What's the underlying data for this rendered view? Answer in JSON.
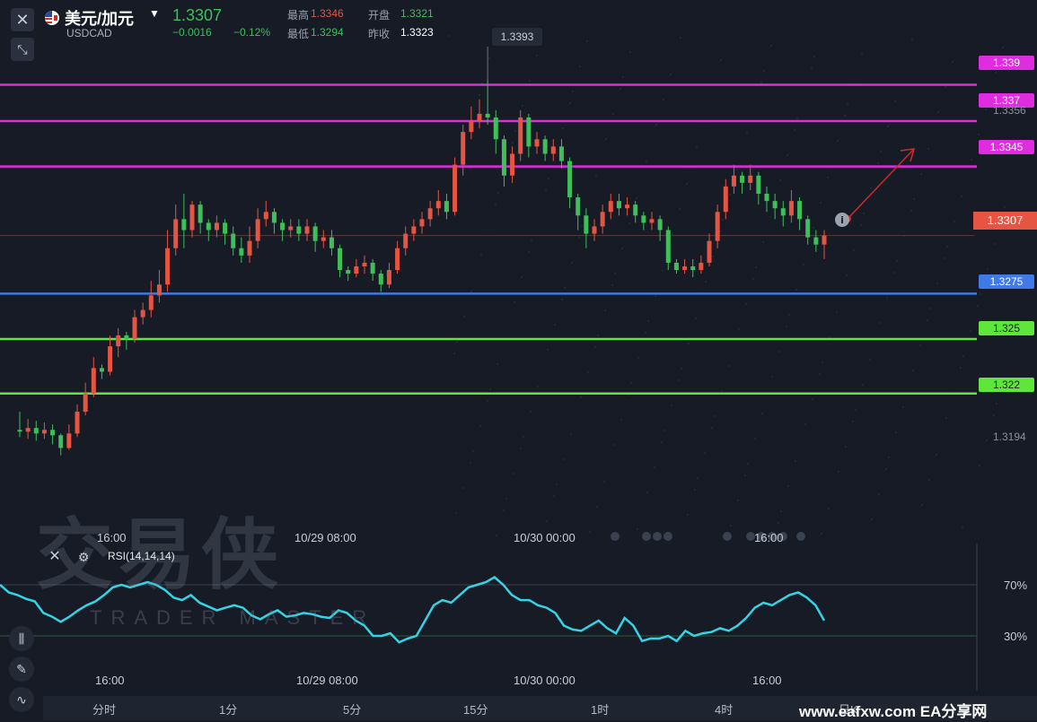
{
  "header": {
    "symbol_title": "美元/加元",
    "symbol_code": "USDCAD",
    "last_price": "1.3307",
    "change_abs": "−0.0016",
    "change_pct": "−0.12%",
    "stats": [
      {
        "label": "最高",
        "value": "1.3346",
        "color": "#e65442"
      },
      {
        "label": "开盘",
        "value": "1.3321",
        "color": "#3fbf5a"
      },
      {
        "label": "最低",
        "value": "1.3294",
        "color": "#3fbf5a"
      },
      {
        "label": "昨收",
        "value": "1.3323",
        "color": "#ffffff"
      }
    ]
  },
  "icons": {
    "close": "close-icon",
    "collapse": "collapse-icon",
    "gear": "gear-icon",
    "info": "info-icon"
  },
  "price_levels": [
    {
      "label": "1.339",
      "value": 1.339,
      "color": "#e02ce0"
    },
    {
      "label": "1.337",
      "value": 1.337,
      "color": "#e02ce0"
    },
    {
      "label": "1.3345",
      "value": 1.3345,
      "color": "#e02ce0"
    },
    {
      "label": "1.3275",
      "value": 1.3275,
      "color": "#3f7ae6"
    },
    {
      "label": "1.325",
      "value": 1.325,
      "color": "#5ee63a"
    },
    {
      "label": "1.322",
      "value": 1.322,
      "color": "#5ee63a"
    }
  ],
  "price_axis_labels": [
    "1.3356",
    "1.3194"
  ],
  "current_price_tag": "1.3307",
  "peak_label": "1.3393",
  "time_axis_top": [
    "16:00",
    "10/29 08:00",
    "10/30 00:00",
    "16:00"
  ],
  "time_axis_bottom": [
    "16:00",
    "10/29 08:00",
    "10/30 00:00",
    "16:00"
  ],
  "rsi": {
    "label": "RSI(14,14,14)",
    "levels": [
      "70%",
      "30%"
    ],
    "color": "#35d3e6",
    "values": [
      70,
      64,
      62,
      59,
      57,
      48,
      45,
      41,
      45,
      50,
      54,
      57,
      62,
      68,
      70,
      68,
      70,
      72,
      70,
      66,
      60,
      58,
      62,
      56,
      53,
      50,
      52,
      54,
      52,
      46,
      43,
      47,
      50,
      45,
      46,
      48,
      47,
      45,
      44,
      50,
      48,
      42,
      38,
      30,
      30,
      32,
      25,
      28,
      30,
      42,
      54,
      58,
      56,
      62,
      68,
      70,
      72,
      76,
      70,
      62,
      58,
      58,
      54,
      52,
      48,
      38,
      35,
      34,
      38,
      42,
      36,
      32,
      44,
      38,
      26,
      28,
      28,
      30,
      26,
      34,
      30,
      32,
      33,
      36,
      34,
      38,
      44,
      52,
      56,
      54,
      58,
      62,
      64,
      60,
      54,
      42
    ]
  },
  "watermark": {
    "main": "交易侠",
    "sub": "TRADER MASTER"
  },
  "timeframes": [
    "分时",
    "1分",
    "5分",
    "15分",
    "1时",
    "4时",
    "日K"
  ],
  "site_credit": "www.eafxw.com EA分享网",
  "chart_data": {
    "type": "candlestick",
    "ylim": [
      1.317,
      1.341
    ],
    "candles": [
      [
        1.32,
        1.3199,
        1.321,
        1.3196
      ],
      [
        1.3199,
        1.3201,
        1.3206,
        1.3195
      ],
      [
        1.3201,
        1.3198,
        1.3205,
        1.3194
      ],
      [
        1.3198,
        1.32,
        1.3204,
        1.3195
      ],
      [
        1.32,
        1.3197,
        1.3203,
        1.3192
      ],
      [
        1.3197,
        1.319,
        1.3198,
        1.3186
      ],
      [
        1.319,
        1.3198,
        1.3203,
        1.3189
      ],
      [
        1.3198,
        1.321,
        1.3214,
        1.3196
      ],
      [
        1.321,
        1.322,
        1.3226,
        1.3208
      ],
      [
        1.322,
        1.3234,
        1.324,
        1.3218
      ],
      [
        1.3234,
        1.3232,
        1.3236,
        1.3228
      ],
      [
        1.3232,
        1.3246,
        1.3252,
        1.323
      ],
      [
        1.3246,
        1.3252,
        1.3256,
        1.324
      ],
      [
        1.3252,
        1.325,
        1.3254,
        1.3244
      ],
      [
        1.325,
        1.3262,
        1.3266,
        1.3248
      ],
      [
        1.3262,
        1.3266,
        1.327,
        1.3258
      ],
      [
        1.3266,
        1.3274,
        1.3282,
        1.3262
      ],
      [
        1.3274,
        1.328,
        1.3288,
        1.327
      ],
      [
        1.328,
        1.33,
        1.331,
        1.3276
      ],
      [
        1.33,
        1.3316,
        1.3324,
        1.3296
      ],
      [
        1.3316,
        1.331,
        1.333,
        1.33
      ],
      [
        1.331,
        1.3324,
        1.3326,
        1.3306
      ],
      [
        1.3324,
        1.3314,
        1.3326,
        1.3308
      ],
      [
        1.3314,
        1.331,
        1.3316,
        1.3304
      ],
      [
        1.331,
        1.3314,
        1.3318,
        1.3306
      ],
      [
        1.3314,
        1.3308,
        1.3316,
        1.3302
      ],
      [
        1.3308,
        1.33,
        1.3312,
        1.3296
      ],
      [
        1.33,
        1.3296,
        1.3306,
        1.3292
      ],
      [
        1.3296,
        1.3304,
        1.3312,
        1.3292
      ],
      [
        1.3304,
        1.3316,
        1.3322,
        1.33
      ],
      [
        1.3316,
        1.332,
        1.3326,
        1.3312
      ],
      [
        1.332,
        1.3314,
        1.3322,
        1.3308
      ],
      [
        1.3314,
        1.331,
        1.3316,
        1.3304
      ],
      [
        1.331,
        1.3312,
        1.3316,
        1.3306
      ],
      [
        1.3312,
        1.3308,
        1.3316,
        1.3304
      ],
      [
        1.3308,
        1.3312,
        1.3316,
        1.3304
      ],
      [
        1.3312,
        1.3304,
        1.3314,
        1.3298
      ],
      [
        1.3304,
        1.3306,
        1.331,
        1.33
      ],
      [
        1.3306,
        1.33,
        1.331,
        1.3296
      ],
      [
        1.33,
        1.3288,
        1.3302,
        1.3284
      ],
      [
        1.3288,
        1.3286,
        1.329,
        1.3282
      ],
      [
        1.3286,
        1.329,
        1.3294,
        1.3284
      ],
      [
        1.329,
        1.3292,
        1.3296,
        1.3286
      ],
      [
        1.3292,
        1.3286,
        1.3294,
        1.3282
      ],
      [
        1.3286,
        1.328,
        1.3288,
        1.3276
      ],
      [
        1.328,
        1.3288,
        1.3292,
        1.3278
      ],
      [
        1.3288,
        1.33,
        1.3304,
        1.3286
      ],
      [
        1.33,
        1.3308,
        1.3312,
        1.3296
      ],
      [
        1.3308,
        1.3312,
        1.3316,
        1.3304
      ],
      [
        1.3312,
        1.3316,
        1.332,
        1.3308
      ],
      [
        1.3316,
        1.3322,
        1.3326,
        1.3312
      ],
      [
        1.3322,
        1.3326,
        1.3332,
        1.3318
      ],
      [
        1.3326,
        1.332,
        1.333,
        1.3316
      ],
      [
        1.332,
        1.3346,
        1.335,
        1.3318
      ],
      [
        1.3346,
        1.3364,
        1.3368,
        1.334
      ],
      [
        1.3364,
        1.337,
        1.3378,
        1.336
      ],
      [
        1.337,
        1.3374,
        1.3382,
        1.3366
      ],
      [
        1.3374,
        1.3372,
        1.3393,
        1.3368
      ],
      [
        1.3372,
        1.336,
        1.3376,
        1.3352
      ],
      [
        1.336,
        1.334,
        1.3362,
        1.3334
      ],
      [
        1.334,
        1.3352,
        1.3356,
        1.3336
      ],
      [
        1.3352,
        1.3372,
        1.3376,
        1.3348
      ],
      [
        1.3372,
        1.3356,
        1.3374,
        1.335
      ],
      [
        1.3356,
        1.336,
        1.3364,
        1.3352
      ],
      [
        1.336,
        1.3352,
        1.3362,
        1.3348
      ],
      [
        1.3352,
        1.3356,
        1.336,
        1.3348
      ],
      [
        1.3356,
        1.3348,
        1.336,
        1.3344
      ],
      [
        1.3348,
        1.3328,
        1.335,
        1.3322
      ],
      [
        1.3328,
        1.3318,
        1.333,
        1.331
      ],
      [
        1.3318,
        1.3308,
        1.3322,
        1.33
      ],
      [
        1.3308,
        1.3312,
        1.3316,
        1.3304
      ],
      [
        1.3312,
        1.332,
        1.3324,
        1.3308
      ],
      [
        1.332,
        1.3326,
        1.333,
        1.3316
      ],
      [
        1.3326,
        1.3322,
        1.333,
        1.3318
      ],
      [
        1.3322,
        1.3324,
        1.3328,
        1.3318
      ],
      [
        1.3324,
        1.3318,
        1.3326,
        1.3314
      ],
      [
        1.3318,
        1.3314,
        1.332,
        1.331
      ],
      [
        1.3314,
        1.3316,
        1.332,
        1.331
      ],
      [
        1.3316,
        1.331,
        1.3318,
        1.3304
      ],
      [
        1.331,
        1.3292,
        1.3312,
        1.3288
      ],
      [
        1.3292,
        1.3288,
        1.3294,
        1.3286
      ],
      [
        1.3288,
        1.329,
        1.3294,
        1.3286
      ],
      [
        1.329,
        1.3288,
        1.3294,
        1.3284
      ],
      [
        1.3288,
        1.3292,
        1.3296,
        1.3286
      ],
      [
        1.3292,
        1.3304,
        1.3308,
        1.329
      ],
      [
        1.3304,
        1.332,
        1.3324,
        1.33
      ],
      [
        1.332,
        1.3334,
        1.3338,
        1.3316
      ],
      [
        1.3334,
        1.334,
        1.3346,
        1.333
      ],
      [
        1.334,
        1.3336,
        1.3342,
        1.333
      ],
      [
        1.3336,
        1.334,
        1.3346,
        1.3332
      ],
      [
        1.334,
        1.333,
        1.3342,
        1.3324
      ],
      [
        1.333,
        1.3326,
        1.3334,
        1.332
      ],
      [
        1.3326,
        1.3322,
        1.333,
        1.3316
      ],
      [
        1.3322,
        1.3318,
        1.3326,
        1.3312
      ],
      [
        1.3318,
        1.3326,
        1.3332,
        1.3314
      ],
      [
        1.3326,
        1.3316,
        1.3328,
        1.331
      ],
      [
        1.3316,
        1.3306,
        1.3318,
        1.3302
      ],
      [
        1.3306,
        1.3302,
        1.331,
        1.3298
      ],
      [
        1.3302,
        1.3307,
        1.331,
        1.3294
      ]
    ]
  }
}
